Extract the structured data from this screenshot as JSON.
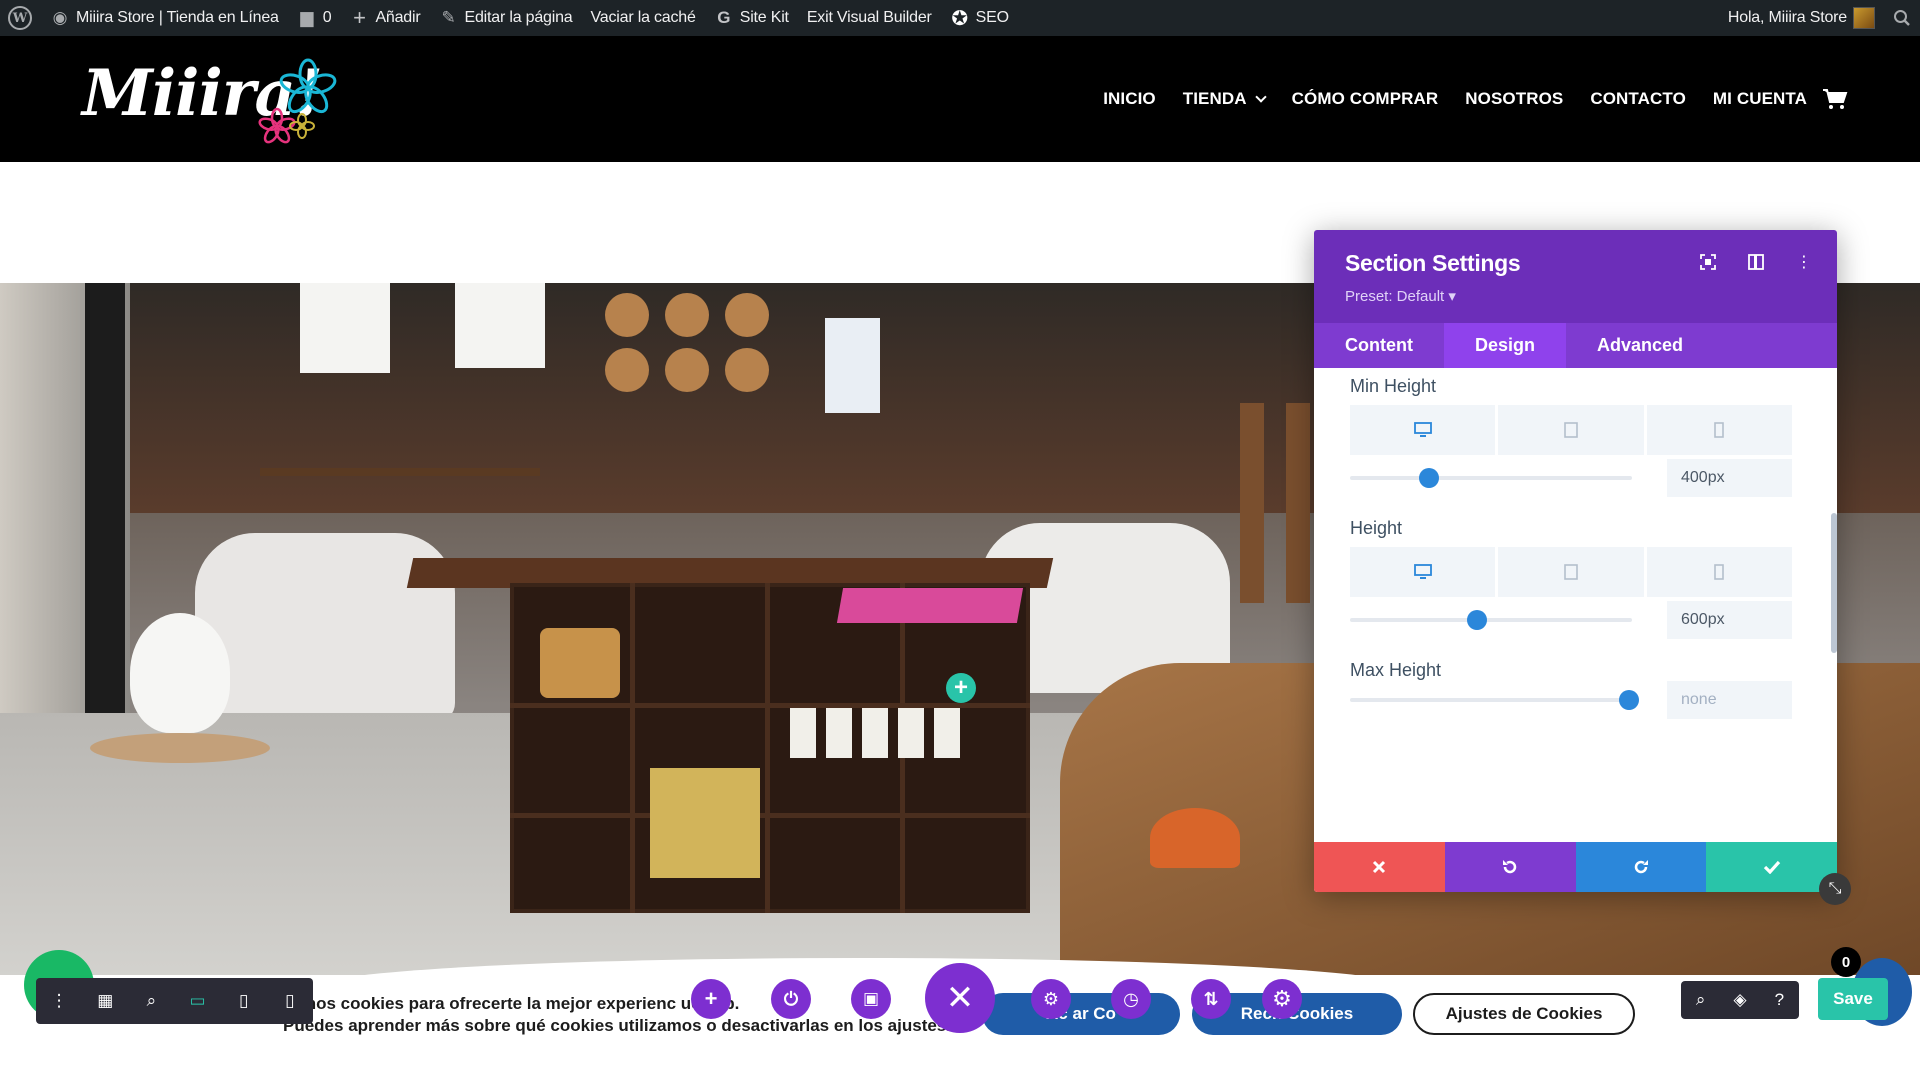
{
  "adminbar": {
    "site_name": "Miiira Store | Tienda en Línea",
    "comments_count": "0",
    "add_label": "Añadir",
    "edit_page_label": "Editar la página",
    "clear_cache_label": "Vaciar la caché",
    "sitekit_label": "Site Kit",
    "exit_vb_label": "Exit Visual Builder",
    "seo_label": "SEO",
    "greeting": "Hola, Miiira Store"
  },
  "header": {
    "logo_text": "Miiira!",
    "nav": [
      "INICIO",
      "TIENDA",
      "CÓMO COMPRAR",
      "NOSOTROS",
      "CONTACTO",
      "MI CUENTA"
    ]
  },
  "panel": {
    "title": "Section Settings",
    "preset": "Preset: Default ▾",
    "tabs": [
      "Content",
      "Design",
      "Advanced"
    ],
    "active_tab": "Design",
    "fields": {
      "min_height": {
        "label": "Min Height",
        "value": "400px",
        "level": 0.28
      },
      "height": {
        "label": "Height",
        "value": "600px",
        "level": 0.45
      },
      "max_height": {
        "label": "Max Height",
        "value": "none",
        "level": 0.99
      }
    }
  },
  "cookie": {
    "line1": "zamos cookies para ofrecerte la mejor experienc     ues   eb.",
    "line2": "Puedes aprender más sobre qué cookies utilizamos o desactivarlas en los ajustes.",
    "accept_label": "Ac   ar Co",
    "reject_label": "Rech   Cookies",
    "settings_label": "Ajustes de Cookies"
  },
  "builder": {
    "save_label": "Save",
    "badge_count": "0"
  },
  "colors": {
    "panel_purple": "#6c2eb9",
    "tab_active": "#8f42ec",
    "accent_blue": "#2b87da",
    "cancel_red": "#ef5555",
    "save_green": "#29c4a9"
  }
}
